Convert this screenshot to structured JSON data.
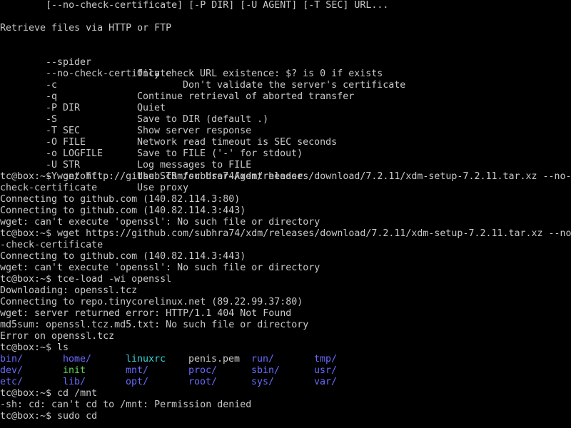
{
  "colors": {
    "background": "#000000",
    "text": "#c9c9c9",
    "directory": "#6a6aff",
    "executable": "#5cd65c",
    "symlink": "#36d4d4"
  },
  "usage": {
    "line": "        [--no-check-certificate] [-P DIR] [-U AGENT] [-T SEC] URL...",
    "description": "Retrieve files via HTTP or FTP",
    "options": [
      {
        "flag": "--spider",
        "desc": "Only check URL existence: $? is 0 if exists"
      },
      {
        "flag": "--no-check-certificate",
        "desc": "Don't validate the server's certificate"
      },
      {
        "flag": "-c",
        "desc": "Continue retrieval of aborted transfer"
      },
      {
        "flag": "-q",
        "desc": "Quiet"
      },
      {
        "flag": "-P DIR",
        "desc": "Save to DIR (default .)"
      },
      {
        "flag": "-S",
        "desc": "Show server response"
      },
      {
        "flag": "-T SEC",
        "desc": "Network read timeout is SEC seconds"
      },
      {
        "flag": "-O FILE",
        "desc": "Save to FILE ('-' for stdout)"
      },
      {
        "flag": "-o LOGFILE",
        "desc": "Log messages to FILE"
      },
      {
        "flag": "-U STR",
        "desc": "Use STR for User-Agent header"
      },
      {
        "flag": "-Y on/off",
        "desc": "Use proxy"
      }
    ]
  },
  "session1": [
    "tc@box:~$ wget http://github.com/subhra74/xdm/releases/download/7.2.11/xdm-setup-7.2.11.tar.xz --no-",
    "check-certificate",
    "Connecting to github.com (140.82.114.3:80)",
    "Connecting to github.com (140.82.114.3:443)",
    "wget: can't execute 'openssl': No such file or directory",
    "tc@box:~$ wget https://github.com/subhra74/xdm/releases/download/7.2.11/xdm-setup-7.2.11.tar.xz --no",
    "-check-certificate",
    "Connecting to github.com (140.82.114.3:443)",
    "wget: can't execute 'openssl': No such file or directory",
    "tc@box:~$ tce-load -wi openssl",
    "Downloading: openssl.tcz",
    "Connecting to repo.tinycorelinux.net (89.22.99.37:80)",
    "wget: server returned error: HTTP/1.1 404 Not Found",
    "md5sum: openssl.tcz.md5.txt: No such file or directory",
    "Error on openssl.tcz",
    "tc@box:~$ ls"
  ],
  "ls": {
    "row1": [
      "bin/",
      "home/",
      "linuxrc",
      "penis.pem",
      "run/",
      "tmp/"
    ],
    "row2": [
      "dev/",
      "init",
      "mnt/",
      "proc/",
      "sbin/",
      "usr/"
    ],
    "row3": [
      "etc/",
      "lib/",
      "opt/",
      "root/",
      "sys/",
      "var/"
    ]
  },
  "session2": [
    "tc@box:~$ cd /mnt",
    "-sh: cd: can't cd to /mnt: Permission denied",
    "tc@box:~$ sudo cd"
  ]
}
